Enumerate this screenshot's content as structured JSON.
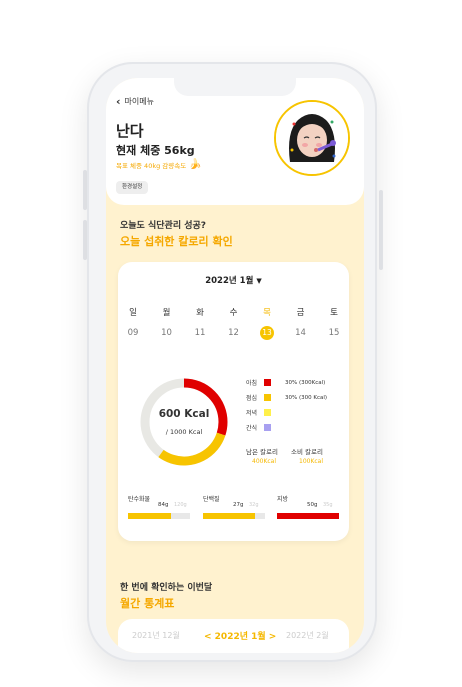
{
  "header": {
    "back_label": "마이메뉴",
    "user_name": "난다",
    "current_weight": "현재 체중 56kg",
    "goal_text": "목표 체중 40kg 감량속도",
    "settings_button": "환경설정"
  },
  "section_today": {
    "subtitle": "오늘도 식단관리 성공?",
    "title": "오늘 섭취한 칼로리 확인"
  },
  "calendar": {
    "month_label": "2022년 1월",
    "caret": "▼",
    "days": [
      {
        "name": "일",
        "date": "09",
        "active": false
      },
      {
        "name": "월",
        "date": "10",
        "active": false
      },
      {
        "name": "화",
        "date": "11",
        "active": false
      },
      {
        "name": "수",
        "date": "12",
        "active": false
      },
      {
        "name": "목",
        "date": "13",
        "active": true
      },
      {
        "name": "금",
        "date": "14",
        "active": false
      },
      {
        "name": "토",
        "date": "15",
        "active": false
      }
    ]
  },
  "calories": {
    "consumed_label": "600 Kcal",
    "goal_label": "/ 1000 Kcal",
    "consumed_fraction": 0.6,
    "breakfast_fraction": 0.3,
    "lunch_fraction": 0.3
  },
  "meals": [
    {
      "label": "아침",
      "color": "#e00000",
      "value": "30% (300Kcal)"
    },
    {
      "label": "점심",
      "color": "#f7c400",
      "value": "30% (300 Kcal)"
    },
    {
      "label": "저녁",
      "color": "#fff04a",
      "value": ""
    },
    {
      "label": "간식",
      "color": "#a8a0f0",
      "value": ""
    }
  ],
  "summary": {
    "remaining_label": "남은 칼로리",
    "remaining_value": "400Kcal",
    "used_label": "소비 칼로리",
    "used_value": "100Kcal"
  },
  "nutrients": [
    {
      "label": "탄수화물",
      "grams": "84g",
      "target": "120g",
      "fraction": 0.7,
      "color": "#f7c400"
    },
    {
      "label": "단백질",
      "grams": "27g",
      "target": "32g",
      "fraction": 0.84,
      "color": "#f7c400"
    },
    {
      "label": "지방",
      "grams": "50g",
      "target": "35g",
      "fraction": 1.0,
      "color": "#e00000"
    }
  ],
  "section_monthly": {
    "subtitle": "한 번에 확인하는 이번달",
    "title": "월간 통계표"
  },
  "month_nav": {
    "prev": "2021년 12월",
    "current": "< 2022년 1월 >",
    "next": "2022년 2월"
  },
  "colors": {
    "accent": "#f7c400",
    "accent_text": "#f5a800",
    "screen_bg": "#fff2cf",
    "red": "#e00000"
  }
}
